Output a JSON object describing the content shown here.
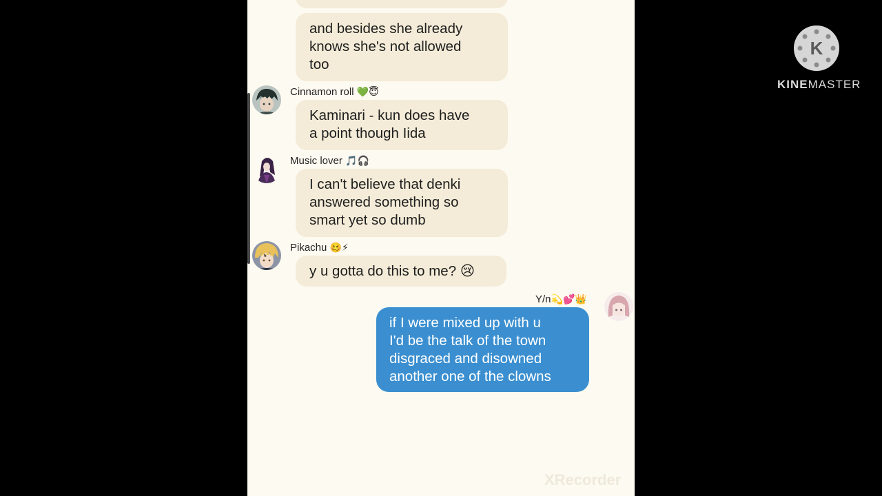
{
  "chat": {
    "messages": [
      {
        "sender": "",
        "lines": [
          "and besides she already",
          "knows she's not allowed",
          "too"
        ]
      },
      {
        "sender": "Cinnamon roll",
        "sender_emoji": "💚😇",
        "avatar_icon": "dark-haired-boy-avatar-icon",
        "lines": [
          "Kaminari - kun does have",
          "a point though Iida"
        ]
      },
      {
        "sender": "Music lover",
        "sender_emoji": "🎵🎧",
        "avatar_icon": "purple-haired-girl-avatar-icon",
        "lines": [
          "I can't believe that denki",
          "answered something so",
          "smart yet so dumb"
        ]
      },
      {
        "sender": "Pikachu",
        "sender_emoji": "🥴⚡",
        "avatar_icon": "blonde-boy-avatar-icon",
        "lines": [
          "y u gotta do this to me? 😢"
        ]
      },
      {
        "sender": "Y/n",
        "sender_emoji": "💫💕👑",
        "avatar_icon": "pink-haired-girl-avatar-icon",
        "outgoing": true,
        "lines": [
          "if I were mixed up with u",
          "I'd be the talk of the town",
          "disgraced and disowned",
          "another one of the clowns"
        ]
      }
    ]
  },
  "overlay": {
    "brand_bold": "KINE",
    "brand_rest": "MASTER",
    "logo_letter": "K",
    "watermark": "XRecorder"
  },
  "colors": {
    "page_bg": "#000000",
    "chat_bg": "#fdfaf1",
    "incoming_bubble": "#f4ecd8",
    "outgoing_bubble": "#3b8fd0"
  }
}
